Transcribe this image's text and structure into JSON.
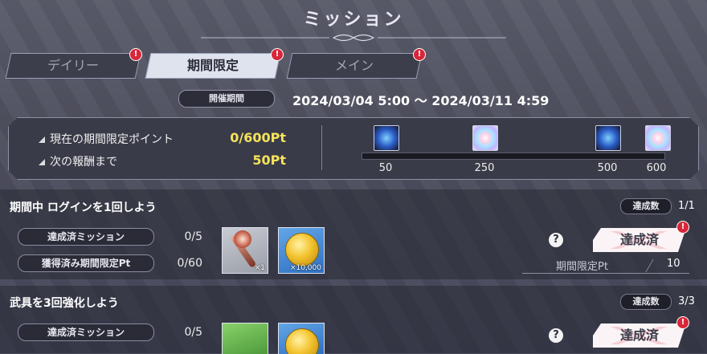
{
  "header": {
    "title": "ミッション"
  },
  "tabs": [
    {
      "label": "デイリー",
      "badge": "!"
    },
    {
      "label": "期間限定",
      "badge": "!"
    },
    {
      "label": "メイン",
      "badge": "!"
    }
  ],
  "period": {
    "label": "開催期間",
    "range": "2024/03/04 5:00 〜 2024/03/11 4:59"
  },
  "points": {
    "current_label": "現在の期間限定ポイント",
    "current_value": "0/600Pt",
    "next_label": "次の報酬まで",
    "next_value": "50Pt",
    "progress_fraction": 0,
    "milestones": [
      {
        "value": "50",
        "icon": "blue-orb-icon"
      },
      {
        "value": "250",
        "icon": "rainbow-orb-icon"
      },
      {
        "value": "500",
        "icon": "blue-orb-icon"
      },
      {
        "value": "600",
        "icon": "rainbow-orb-icon"
      }
    ]
  },
  "missions": [
    {
      "title": "期間中 ログインを1回しよう",
      "tally_label": "達成数",
      "tally_value": "1/1",
      "completed_label": "達成済ミッション",
      "completed_value": "0/5",
      "earned_label": "獲得済み期間限定Pt",
      "earned_value": "0/60",
      "rewards": [
        {
          "icon": "staff-icon",
          "qty": "×1"
        },
        {
          "icon": "gold-coin-icon",
          "qty": "×10,000"
        }
      ],
      "help": "?",
      "status_button": "達成済",
      "status_badge": "!",
      "reward_pt_label": "期間限定Pt",
      "reward_pt_value": "10"
    },
    {
      "title": "武具を3回強化しよう",
      "tally_label": "達成数",
      "tally_value": "3/3",
      "completed_label": "達成済ミッション",
      "completed_value": "0/5",
      "help": "?",
      "status_button": "達成済",
      "status_badge": "!"
    }
  ]
}
